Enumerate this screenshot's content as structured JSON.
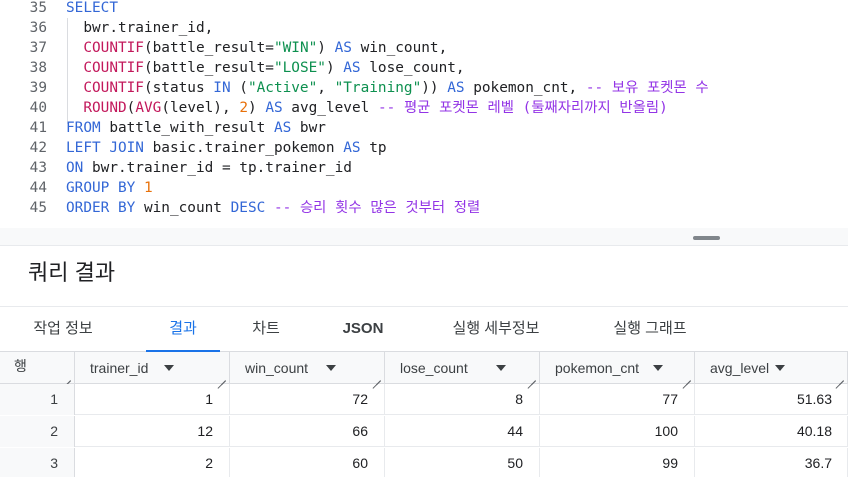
{
  "editor": {
    "lines": [
      {
        "n": "35",
        "tokens": [
          {
            "t": "SELECT",
            "c": "kw"
          }
        ]
      },
      {
        "n": "36",
        "tokens": [
          {
            "t": "  bwr.trainer_id,",
            "c": "id"
          }
        ]
      },
      {
        "n": "37",
        "tokens": [
          {
            "t": "  COUNTIF",
            "c": "fn"
          },
          {
            "t": "(battle_result=",
            "c": "id"
          },
          {
            "t": "\"WIN\"",
            "c": "str"
          },
          {
            "t": ") ",
            "c": "id"
          },
          {
            "t": "AS",
            "c": "kw"
          },
          {
            "t": " win_count,",
            "c": "id"
          }
        ]
      },
      {
        "n": "38",
        "tokens": [
          {
            "t": "  COUNTIF",
            "c": "fn"
          },
          {
            "t": "(battle_result=",
            "c": "id"
          },
          {
            "t": "\"LOSE\"",
            "c": "str"
          },
          {
            "t": ") ",
            "c": "id"
          },
          {
            "t": "AS",
            "c": "kw"
          },
          {
            "t": " lose_count,",
            "c": "id"
          }
        ]
      },
      {
        "n": "39",
        "tokens": [
          {
            "t": "  COUNTIF",
            "c": "fn"
          },
          {
            "t": "(status ",
            "c": "id"
          },
          {
            "t": "IN",
            "c": "kw"
          },
          {
            "t": " (",
            "c": "id"
          },
          {
            "t": "\"Active\"",
            "c": "str"
          },
          {
            "t": ", ",
            "c": "id"
          },
          {
            "t": "\"Training\"",
            "c": "str"
          },
          {
            "t": ")) ",
            "c": "id"
          },
          {
            "t": "AS",
            "c": "kw"
          },
          {
            "t": " pokemon_cnt, ",
            "c": "id"
          },
          {
            "t": "-- 보유 포켓몬 수",
            "c": "cm"
          }
        ]
      },
      {
        "n": "40",
        "tokens": [
          {
            "t": "  ROUND",
            "c": "fn"
          },
          {
            "t": "(",
            "c": "id"
          },
          {
            "t": "AVG",
            "c": "fn"
          },
          {
            "t": "(level), ",
            "c": "id"
          },
          {
            "t": "2",
            "c": "num"
          },
          {
            "t": ") ",
            "c": "id"
          },
          {
            "t": "AS",
            "c": "kw"
          },
          {
            "t": " avg_level ",
            "c": "id"
          },
          {
            "t": "-- 평균 포켓몬 레벨 (둘째자리까지 반올림)",
            "c": "cm"
          }
        ]
      },
      {
        "n": "41",
        "tokens": [
          {
            "t": "FROM",
            "c": "kw"
          },
          {
            "t": " battle_with_result ",
            "c": "id"
          },
          {
            "t": "AS",
            "c": "kw"
          },
          {
            "t": " bwr",
            "c": "id"
          }
        ]
      },
      {
        "n": "42",
        "tokens": [
          {
            "t": "LEFT JOIN",
            "c": "kw"
          },
          {
            "t": " basic.trainer_pokemon ",
            "c": "id"
          },
          {
            "t": "AS",
            "c": "kw"
          },
          {
            "t": " tp",
            "c": "id"
          }
        ]
      },
      {
        "n": "43",
        "tokens": [
          {
            "t": "ON",
            "c": "kw"
          },
          {
            "t": " bwr.trainer_id = tp.trainer_id",
            "c": "id"
          }
        ]
      },
      {
        "n": "44",
        "tokens": [
          {
            "t": "GROUP BY",
            "c": "kw"
          },
          {
            "t": " ",
            "c": "id"
          },
          {
            "t": "1",
            "c": "num"
          }
        ]
      },
      {
        "n": "45",
        "tokens": [
          {
            "t": "ORDER BY",
            "c": "kw"
          },
          {
            "t": " win_count ",
            "c": "id"
          },
          {
            "t": "DESC",
            "c": "kw"
          },
          {
            "t": " ",
            "c": "id"
          },
          {
            "t": "-- 승리 횟수 많은 것부터 정렬",
            "c": "cm"
          }
        ]
      }
    ]
  },
  "results": {
    "title": "쿼리 결과",
    "tabs": [
      "작업 정보",
      "결과",
      "차트",
      "JSON",
      "실행 세부정보",
      "실행 그래프"
    ],
    "active_tab": "결과",
    "row_header": "행",
    "columns": [
      "trainer_id",
      "win_count",
      "lose_count",
      "pokemon_cnt",
      "avg_level"
    ],
    "rows": [
      {
        "row": "1",
        "cells": [
          "1",
          "72",
          "8",
          "77",
          "51.63"
        ]
      },
      {
        "row": "2",
        "cells": [
          "12",
          "66",
          "44",
          "100",
          "40.18"
        ]
      },
      {
        "row": "3",
        "cells": [
          "2",
          "60",
          "50",
          "99",
          "36.7"
        ]
      }
    ]
  }
}
